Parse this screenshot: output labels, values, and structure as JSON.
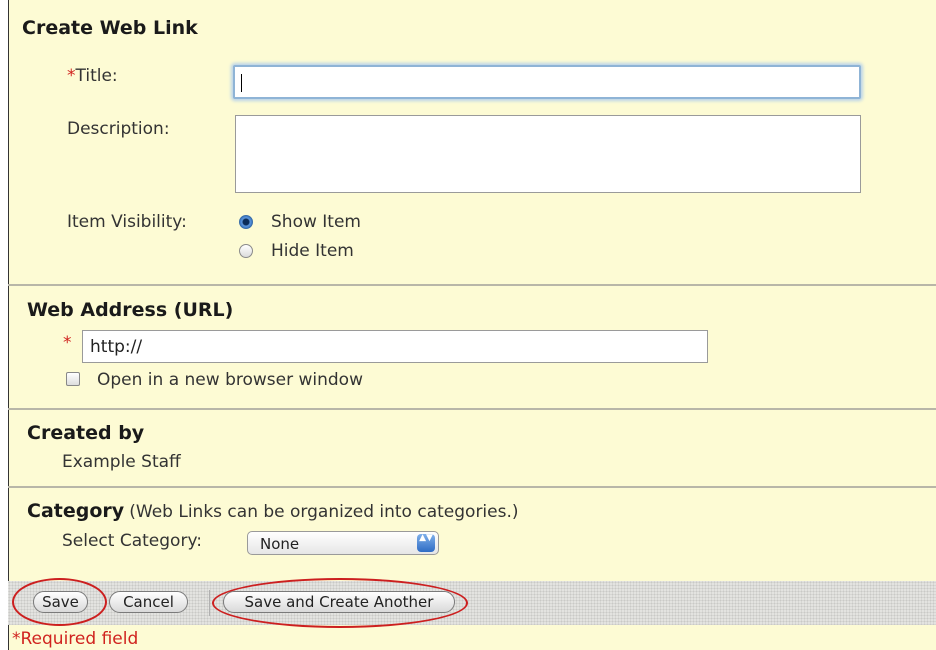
{
  "form": {
    "heading": "Create Web Link",
    "required_marker": "*",
    "title_label": "Title:",
    "title_value": "",
    "description_label": "Description:",
    "description_value": "",
    "visibility_label": "Item Visibility:",
    "visibility_options": [
      {
        "label": "Show Item",
        "selected": true
      },
      {
        "label": "Hide Item",
        "selected": false
      }
    ]
  },
  "web_address": {
    "heading": "Web Address (URL)",
    "required_marker": "*",
    "url_value": "http://",
    "new_window_label": "Open in a new browser window",
    "new_window_checked": false
  },
  "created_by": {
    "heading": "Created by",
    "value": "Example Staff"
  },
  "category": {
    "heading": "Category",
    "hint": "(Web Links can be organized into categories.)",
    "select_label": "Select Category:",
    "selected": "None",
    "arrows": "▲▼"
  },
  "buttons": {
    "save": "Save",
    "cancel": "Cancel",
    "save_and_create": "Save and Create Another"
  },
  "footer": {
    "required_note": "*Required field"
  },
  "colors": {
    "background": "#fdfbd4",
    "required": "#d0231f",
    "highlight_ring": "#cc1f1f",
    "focus": "#8fb4d6"
  }
}
